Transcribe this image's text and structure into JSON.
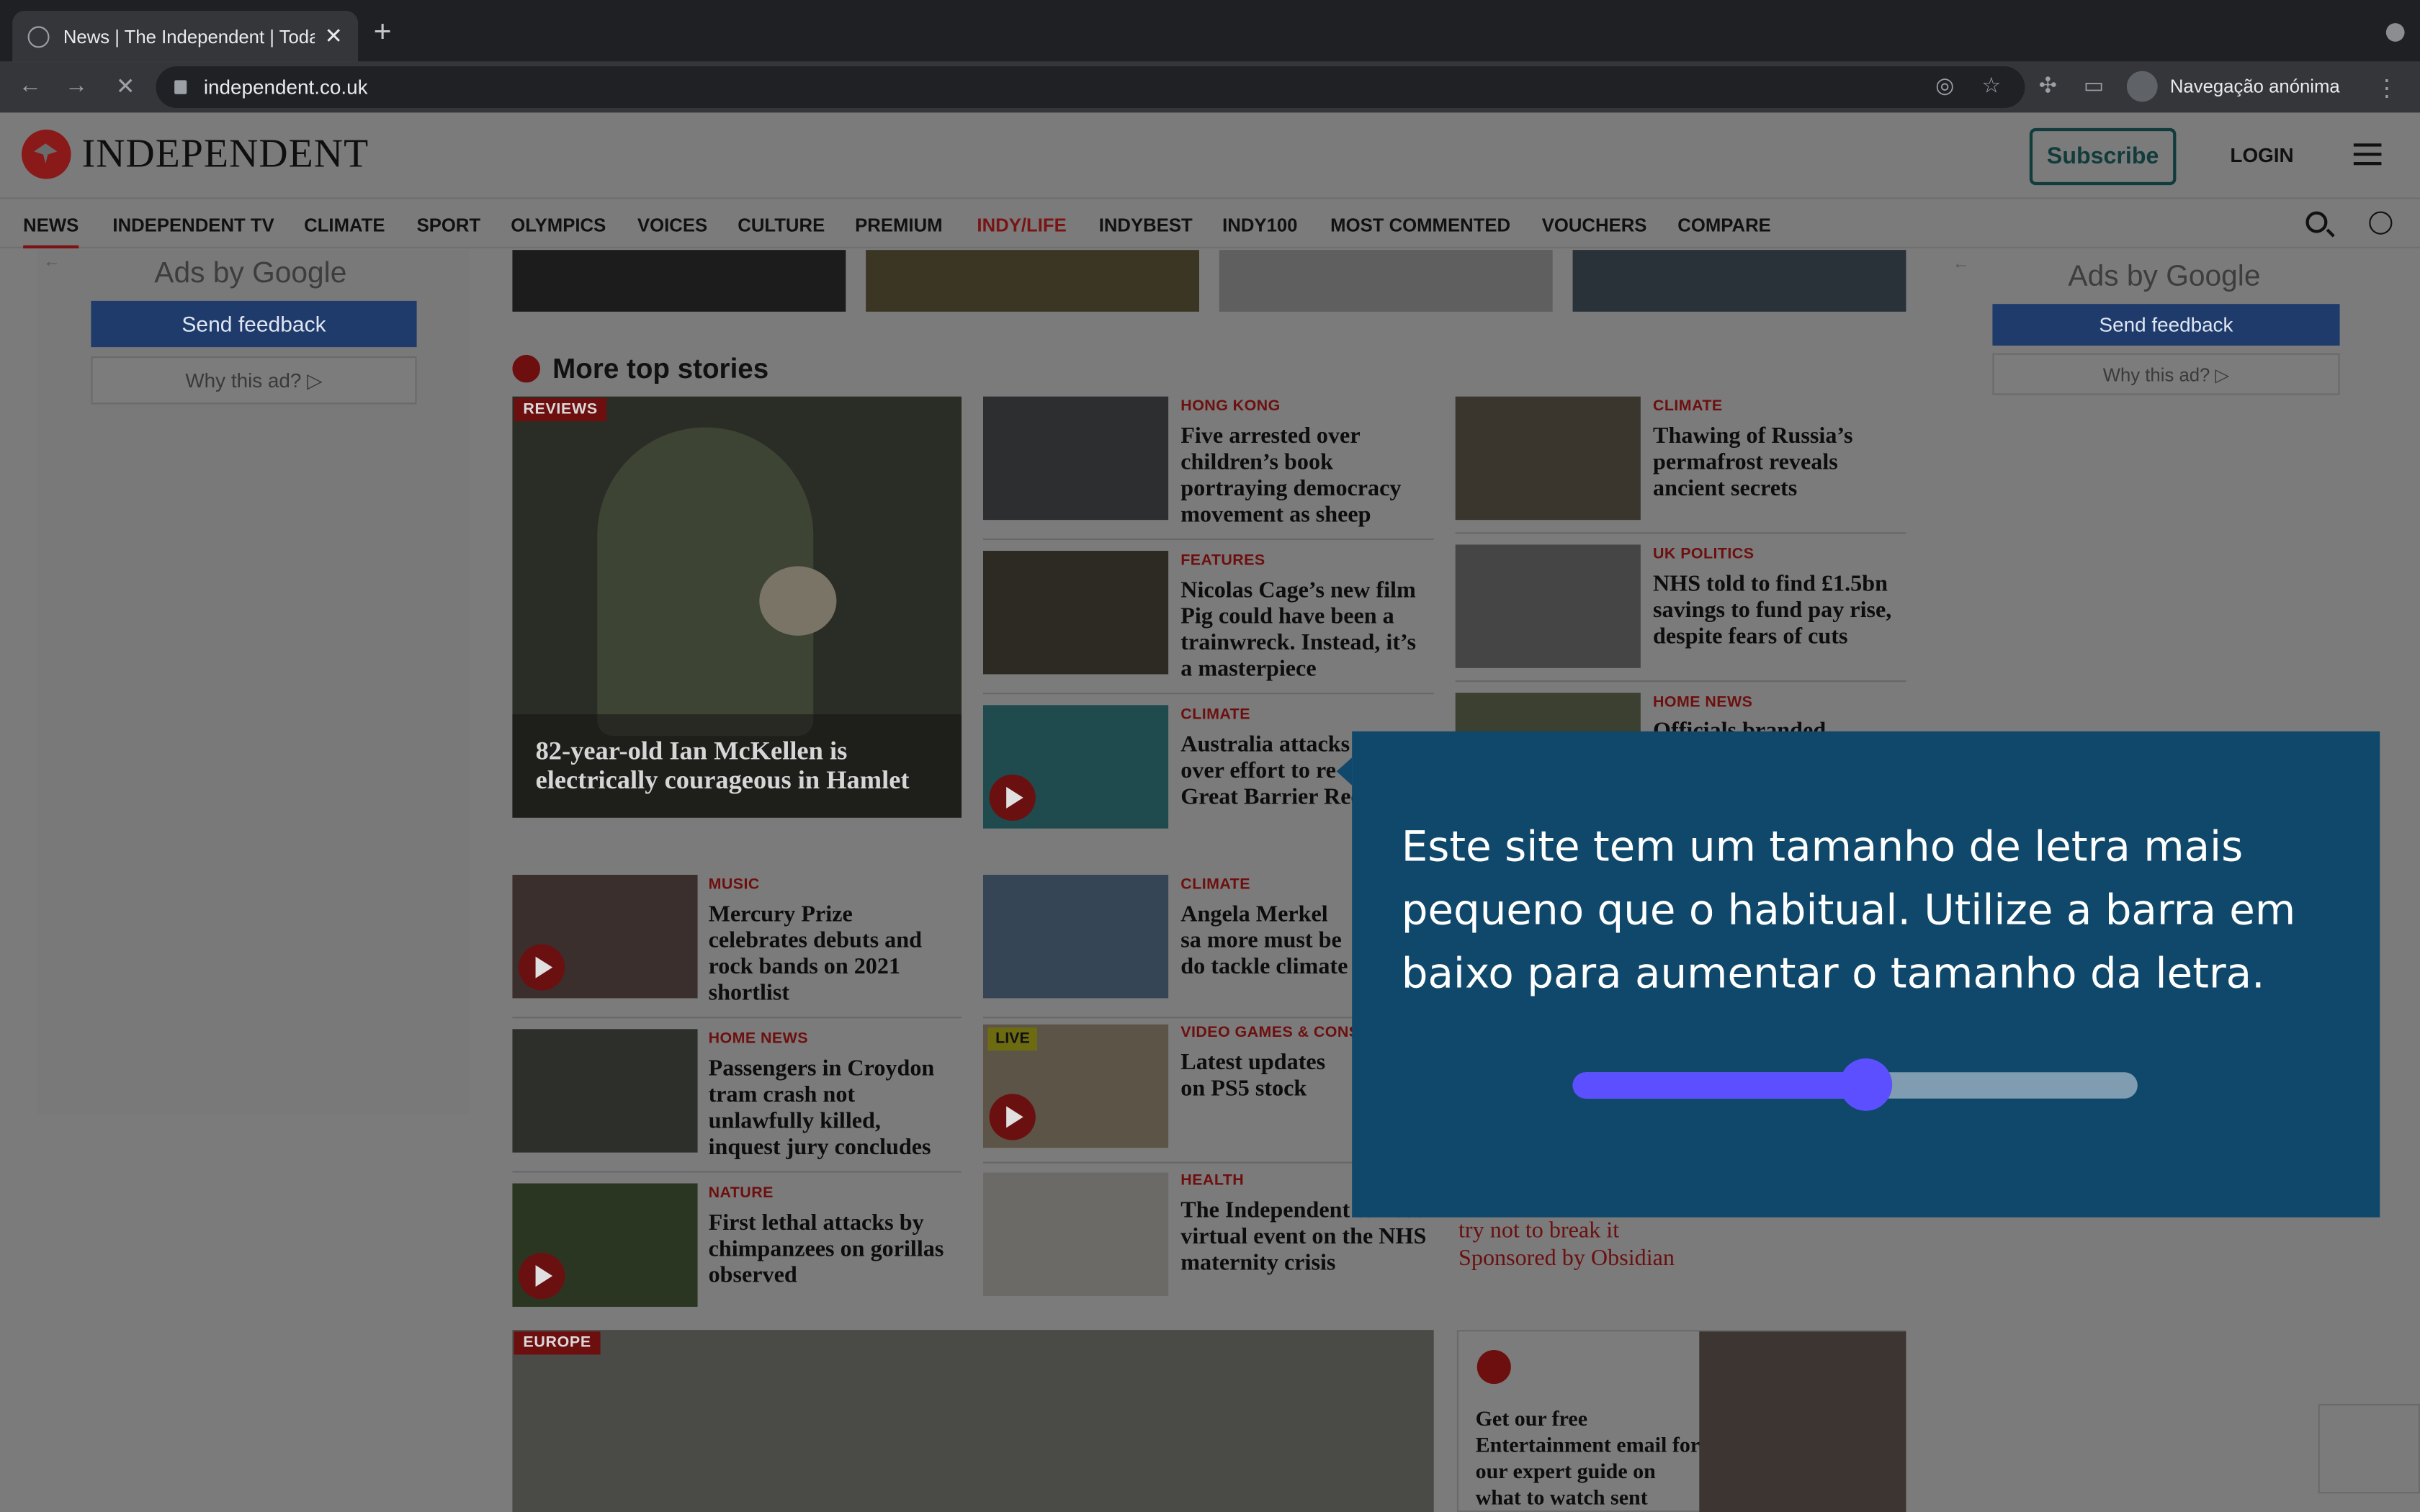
{
  "browser": {
    "tab_title": "News | The Independent | Toda",
    "url": "independent.co.uk",
    "profile_label": "Navegação anónima"
  },
  "site": {
    "logo_text": "INDEPENDENT",
    "subscribe_label": "Subscribe",
    "login_label": "LOGIN",
    "nav": [
      "NEWS",
      "INDEPENDENT TV",
      "CLIMATE",
      "SPORT",
      "OLYMPICS",
      "VOICES",
      "CULTURE",
      "PREMIUM",
      "INDY/LIFE",
      "INDYBEST",
      "INDY100",
      "MOST COMMENTED",
      "VOUCHERS",
      "COMPARE"
    ],
    "nav_indy": "INDY/",
    "nav_life": "LIFE"
  },
  "ads": {
    "left": {
      "title": "Ads by Google",
      "send": "Send feedback",
      "why": "Why this ad? ▷"
    },
    "right": {
      "title": "Ads by Google",
      "send": "Send feedback",
      "why": "Why this ad? ▷"
    }
  },
  "section": {
    "title": "More top stories",
    "hero_badge": "REVIEWS",
    "hero_headline": "82-year-old Ian McKellen is electrically courageous in Hamlet",
    "europe_badge": "EUROPE",
    "live_badge": "LIVE"
  },
  "stories": {
    "s1": {
      "cat": "HONG KONG",
      "hl": "Five arrested over children’s book portraying democracy movement as sheep"
    },
    "s2": {
      "cat": "FEATURES",
      "hl": "Nicolas Cage’s new film Pig could have been a trainwreck. Instead, it’s a masterpiece"
    },
    "s3": {
      "cat": "CLIMATE",
      "hl": "Australia attacks over effort to re Great Barrier Ree"
    },
    "s4": {
      "cat": "CLIMATE",
      "hl": "Thawing of Russia’s permafrost reveals ancient secrets"
    },
    "s5": {
      "cat": "UK POLITICS",
      "hl": "NHS told to find £1.5bn savings to fund pay rise, despite fears of cuts"
    },
    "s6": {
      "cat": "HOME NEWS",
      "hl": "Officials branded"
    },
    "s7": {
      "cat": "MUSIC",
      "hl": "Mercury Prize celebrates debuts and rock bands on 2021 shortlist"
    },
    "s8": {
      "cat": "HOME NEWS",
      "hl": "Passengers in Croydon tram crash not unlawfully killed, inquest jury concludes"
    },
    "s9": {
      "cat": "NATURE",
      "hl": "First lethal attacks by chimpanzees on gorillas observed"
    },
    "s10": {
      "cat": "CLIMATE",
      "hl": "Angela Merkel sa more must be do tackle climate ch"
    },
    "s11": {
      "cat": "VIDEO GAMES & CONS",
      "hl": "Latest updates on PS5 stock"
    },
    "s12": {
      "cat": "HEALTH",
      "hl": "The Independent to host virtual event on the NHS maternity crisis"
    }
  },
  "sponsored": {
    "line1": "try not to break it",
    "line2": "Sponsored by Obsidian"
  },
  "promo": {
    "text": "Get our free Entertainment email for our expert guide on what to watch sent"
  },
  "overlay": {
    "message": "Este site tem um tamanho de letra mais pequeno que o habitual. Utilize a barra em baixo para aumentar o tamanho da letra.",
    "slider_value": 0.52
  },
  "colors": {
    "overlay_bg": "#0f486b",
    "slider_accent": "#5b4fff",
    "brand_red": "#b01c1c"
  }
}
